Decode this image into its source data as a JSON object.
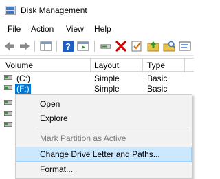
{
  "window": {
    "title": "Disk Management"
  },
  "menu": [
    "File",
    "Action",
    "View",
    "Help"
  ],
  "toolbar": {
    "icons": [
      "back-arrow-icon",
      "forward-arrow-icon",
      "console-tree-icon",
      "help-icon",
      "action-pane-icon",
      "connect-icon",
      "delete-icon",
      "check-icon",
      "open-icon",
      "explore-icon",
      "properties-icon"
    ],
    "colors": {
      "delete": "#d40000",
      "help": "#1f5fbf",
      "folder": "#e8c34a"
    }
  },
  "columns": {
    "volume": "Volume",
    "layout": "Layout",
    "type": "Type"
  },
  "rows": [
    {
      "volume": "(C:)",
      "layout": "Simple",
      "type": "Basic"
    },
    {
      "volume": "(F:)",
      "layout": "Simple",
      "type": "Basic"
    }
  ],
  "context_menu": {
    "open": "Open",
    "explore": "Explore",
    "mark_active": "Mark Partition as Active",
    "change_letter": "Change Drive Letter and Paths...",
    "format": "Format..."
  },
  "colors": {
    "selection": "#0078d7",
    "menu_highlight": "#cce8ff"
  }
}
